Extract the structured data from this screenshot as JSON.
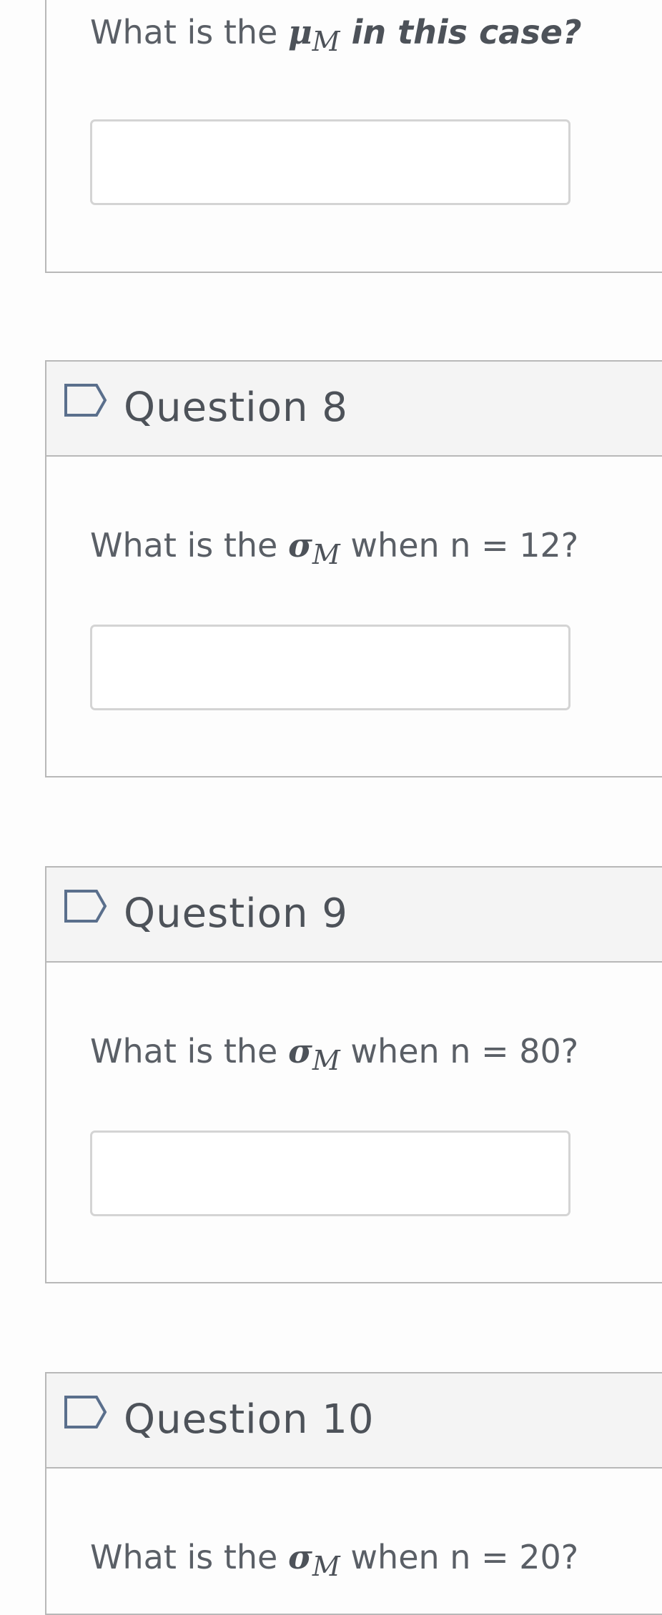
{
  "question7": {
    "text_prefix": "What is the ",
    "math_symbol": "μ",
    "math_subscript": "M",
    "text_suffix": " in this case?",
    "answer_value": ""
  },
  "question8": {
    "title": "Question 8",
    "text_prefix": "What is the ",
    "math_symbol": "σ",
    "math_subscript": "M",
    "text_suffix": " when n = 12?",
    "answer_value": ""
  },
  "question9": {
    "title": "Question 9",
    "text_prefix": "What is the ",
    "math_symbol": "σ",
    "math_subscript": "M",
    "text_suffix": " when n = 80?",
    "answer_value": ""
  },
  "question10": {
    "title": "Question 10",
    "text_prefix": "What is the ",
    "math_symbol": "σ",
    "math_subscript": "M",
    "text_suffix": " when n = 20?"
  },
  "icons": {
    "flag": "flag-outline-icon"
  },
  "colors": {
    "header_bg": "#f4f4f4",
    "border": "#b8b8b8",
    "flag_stroke": "#5a6f8c"
  }
}
